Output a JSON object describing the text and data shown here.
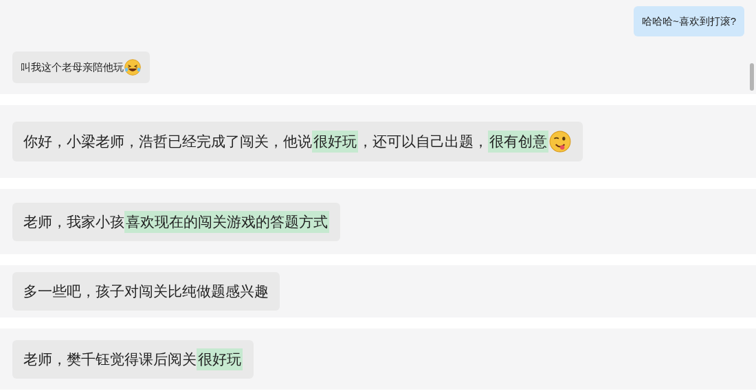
{
  "panels": [
    {
      "kind": "small",
      "messages": [
        {
          "kind": "sent",
          "segments": [
            {
              "kind": "text",
              "text": "哈哈哈~喜欢到打滚?",
              "highlighted": false
            }
          ]
        },
        {
          "kind": "received",
          "segments": [
            {
              "kind": "text",
              "text": "叫我这个老母亲陪他玩",
              "highlighted": false
            },
            {
              "kind": "laughing"
            }
          ]
        }
      ]
    },
    {
      "kind": "large",
      "messages": [
        {
          "kind": "received",
          "segments": [
            {
              "kind": "text",
              "text": "你好，小梁老师，浩哲已经完成了闯关，他说",
              "highlighted": false
            },
            {
              "kind": "text",
              "text": "很好玩",
              "highlighted": true
            },
            {
              "kind": "text",
              "text": "，还可以自己出题，",
              "highlighted": false
            },
            {
              "kind": "text",
              "text": "很有创意",
              "highlighted": true
            },
            {
              "kind": "wink"
            }
          ]
        }
      ]
    },
    {
      "kind": "large",
      "messages": [
        {
          "kind": "received",
          "segments": [
            {
              "kind": "text",
              "text": "老师，我家小孩",
              "highlighted": false
            },
            {
              "kind": "text",
              "text": "喜欢现在的闯关游戏的答题方式",
              "highlighted": true
            }
          ]
        }
      ]
    },
    {
      "kind": "large",
      "messages": [
        {
          "kind": "received",
          "segments": [
            {
              "kind": "text",
              "text": "多一些吧，孩子对闯关比纯做题感兴趣",
              "highlighted": false
            }
          ]
        }
      ]
    },
    {
      "kind": "large",
      "messages": [
        {
          "kind": "received",
          "segments": [
            {
              "kind": "text",
              "text": "老师，樊千钰觉得课后阅关",
              "highlighted": false
            },
            {
              "kind": "text",
              "text": "很好玩",
              "highlighted": true
            }
          ]
        }
      ]
    }
  ]
}
